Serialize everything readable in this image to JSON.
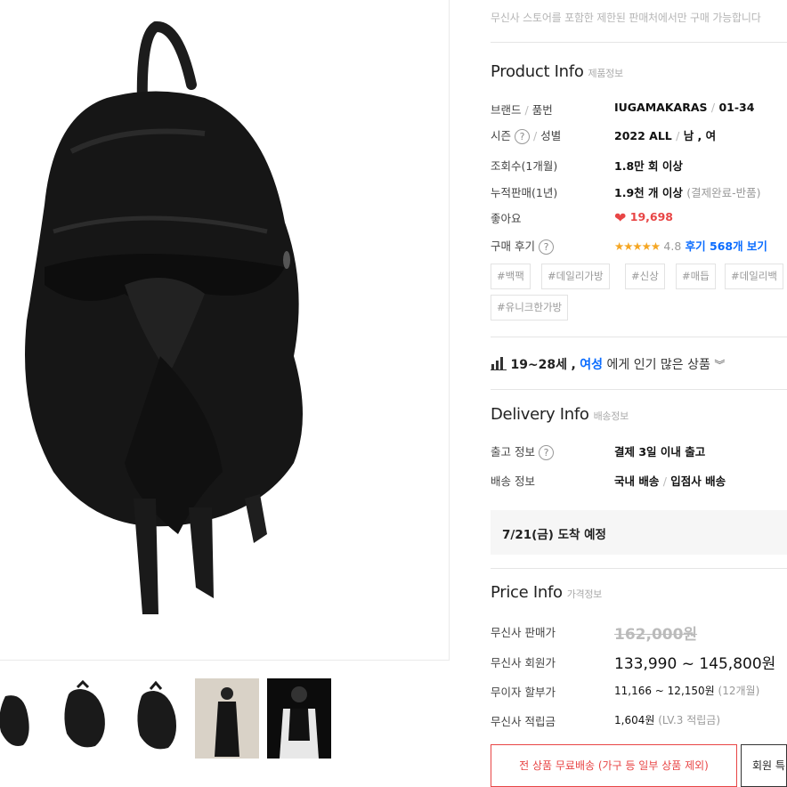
{
  "notice": "무신사 스토어를 포함한 제한된 판매처에서만 구매 가능합니다",
  "product_info": {
    "title": "Product Info",
    "subtitle": "제품정보",
    "brand_label": "브랜드",
    "code_label": "품번",
    "brand": "IUGAMAKARAS",
    "code": "01-34",
    "season_label": "시즌",
    "gender_label": "성별",
    "season": "2022 ALL",
    "gender": "남 , 여",
    "views_label": "조회수(1개월)",
    "views": "1.8만 회 이상",
    "sales_label": "누적판매(1년)",
    "sales": "1.9천 개 이상",
    "sales_note": "(결제완료-반품)",
    "likes_label": "좋아요",
    "likes": "19,698",
    "review_label": "구매 후기",
    "stars": "★★★★★",
    "rating": "4.8",
    "review_count": "후기 568개 보기",
    "tags": [
      "#백팩",
      "#데일리가방",
      "#신상",
      "#매듭",
      "#데일리백",
      "#유니크한가방"
    ]
  },
  "popular": {
    "age": "19~28세",
    "comma": ",",
    "gender": "여성",
    "suffix": "에게 인기 많은 상품"
  },
  "delivery_info": {
    "title": "Delivery Info",
    "subtitle": "배송정보",
    "release_label": "출고 정보",
    "release": "결제 3일 이내 출고",
    "ship_label": "배송 정보",
    "ship_domestic": "국내 배송",
    "ship_type": "입점사 배송",
    "arrival": "7/21(금) 도착 예정"
  },
  "price_info": {
    "title": "Price Info",
    "subtitle": "가격정보",
    "sale_label": "무신사 판매가",
    "sale_price": "162,000원",
    "member_label": "무신사 회원가",
    "member_price": "133,990 ~ 145,800원",
    "installment_label": "무이자 할부가",
    "installment": "11,166 ~ 12,150원",
    "installment_months": "(12개월)",
    "points_label": "무신사 적립금",
    "points": "1,604원",
    "points_note": "(LV.3 적립금)"
  },
  "buttons": {
    "free_shipping": "전 상품 무료배송 (가구 등 일부 상품 제외)",
    "member": "회원 특"
  },
  "colors": {
    "accent_red": "#e84545",
    "link_blue": "#0a6cff",
    "star": "#f5a623"
  }
}
